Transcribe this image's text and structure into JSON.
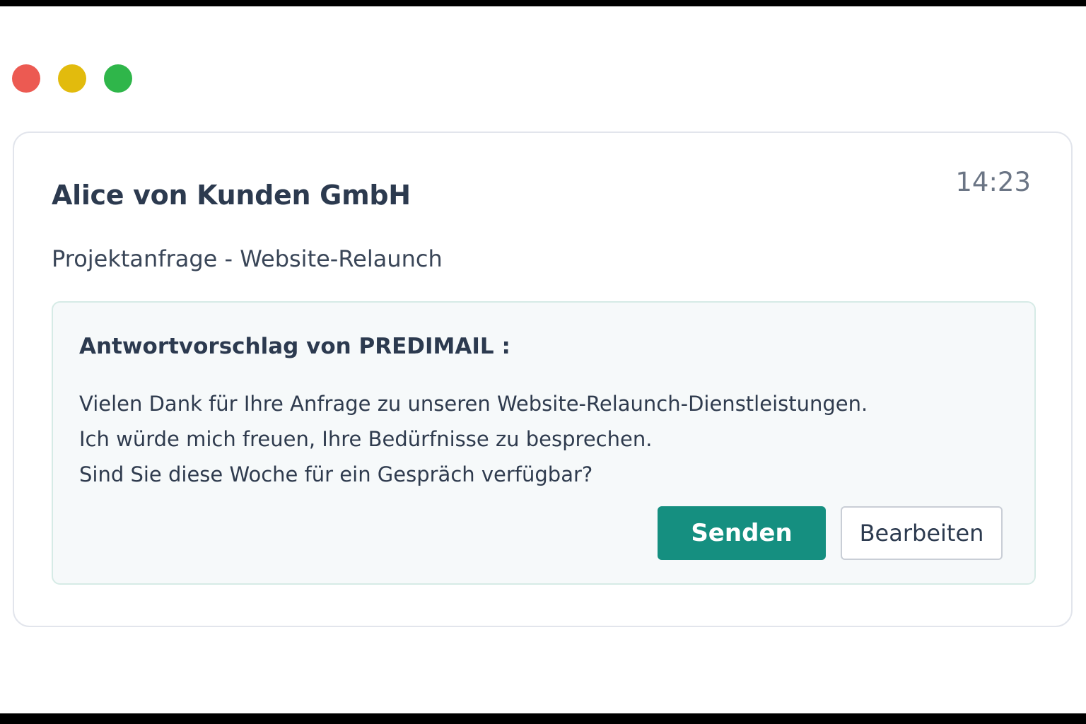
{
  "window": {
    "controls": [
      {
        "name": "close",
        "color": "#ec5a52"
      },
      {
        "name": "minimize",
        "color": "#e2bb0d"
      },
      {
        "name": "zoom",
        "color": "#2fb64a"
      }
    ]
  },
  "email": {
    "sender": "Alice von Kunden GmbH",
    "time": "14:23",
    "subject": "Projektanfrage - Website-Relaunch"
  },
  "suggestion": {
    "title": "Antwortvorschlag von PREDIMAIL :",
    "lines": [
      "Vielen Dank für Ihre Anfrage zu unseren Website-Relaunch-Dienstleistungen.",
      "Ich würde mich freuen, Ihre Bedürfnisse zu besprechen.",
      "Sind Sie diese Woche für ein Gespräch verfügbar?"
    ],
    "send_label": "Senden",
    "edit_label": "Bearbeiten"
  },
  "colors": {
    "accent": "#158f80",
    "suggestion_bg": "#f6f9fa"
  }
}
